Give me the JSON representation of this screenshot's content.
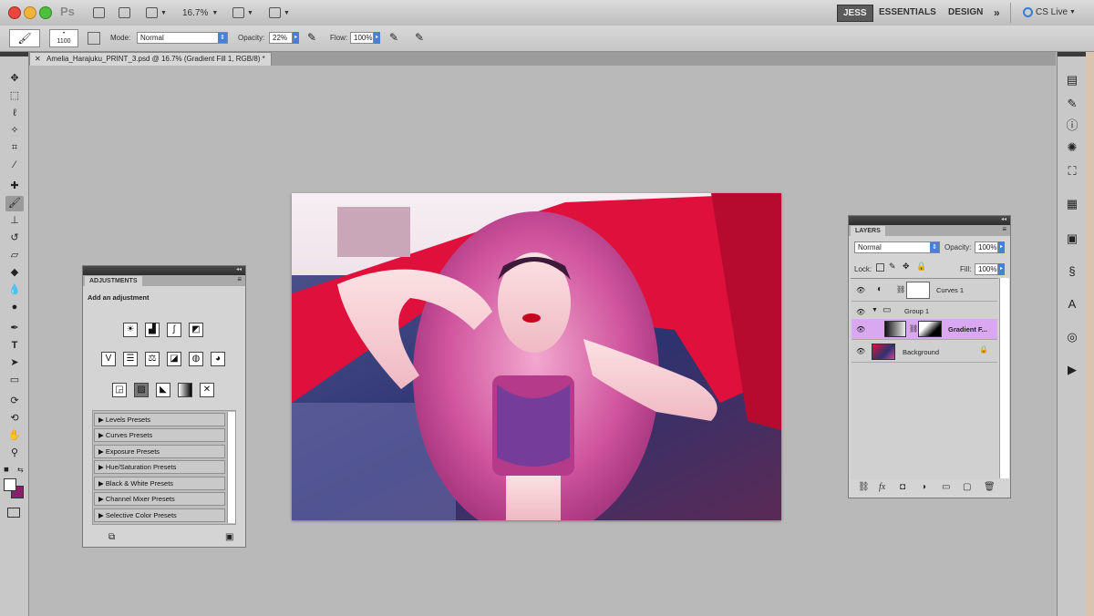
{
  "app": {
    "logo": "Ps",
    "zoom": "16.7%",
    "workspaces": {
      "active": "JESS",
      "essentials": "ESSENTIALS",
      "design": "DESIGN",
      "more": "»"
    },
    "cs_live": "CS Live"
  },
  "options_bar": {
    "brush_size": "1100",
    "mode_label": "Mode:",
    "mode_value": "Normal",
    "opacity_label": "Opacity:",
    "opacity_value": "22%",
    "flow_label": "Flow:",
    "flow_value": "100%"
  },
  "document": {
    "tab_title": "Amelia_Harajuku_PRINT_3.psd @ 16.7% (Gradient Fill 1, RGB/8) *"
  },
  "adjustments_panel": {
    "tab": "ADJUSTMENTS",
    "subtitle": "Add an adjustment",
    "presets": [
      "Levels Presets",
      "Curves Presets",
      "Exposure Presets",
      "Hue/Saturation Presets",
      "Black & White Presets",
      "Channel Mixer Presets",
      "Selective Color Presets"
    ]
  },
  "layers_panel": {
    "tab": "LAYERS",
    "blend_mode": "Normal",
    "opacity_label": "Opacity:",
    "opacity_value": "100%",
    "lock_label": "Lock:",
    "fill_label": "Fill:",
    "fill_value": "100%",
    "layers": [
      {
        "name": "Curves 1"
      },
      {
        "name": "Group 1"
      },
      {
        "name": "Gradient F..."
      },
      {
        "name": "Background"
      }
    ]
  },
  "colors": {
    "selected_layer": "#d9a8f0",
    "accent_blue": "#4a7fd6",
    "photo_red": "#e0103c",
    "photo_pink": "#c94a9a"
  }
}
